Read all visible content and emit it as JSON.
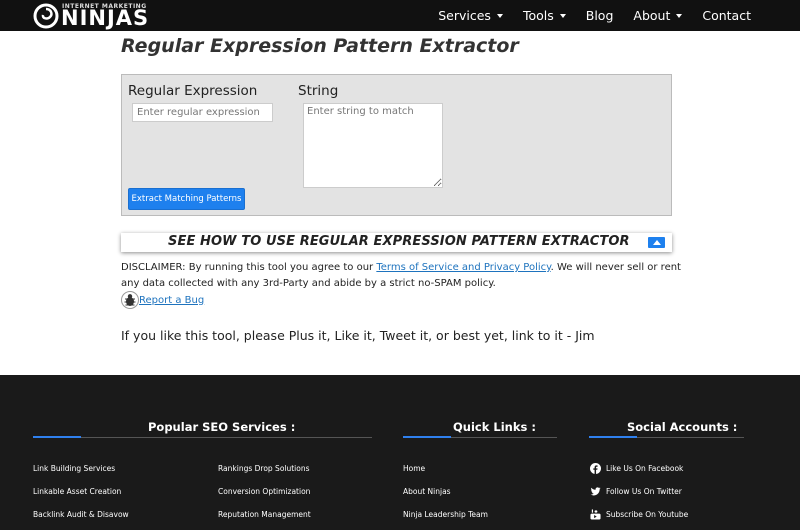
{
  "header": {
    "logo_small": "INTERNET MARKETING",
    "logo_big": "NINJAS",
    "nav": [
      "Services",
      "Tools",
      "Blog",
      "About",
      "Contact"
    ]
  },
  "main": {
    "title": "Regular Expression Pattern Extractor",
    "regex_label": "Regular Expression",
    "regex_placeholder": "Enter regular expression",
    "regex_value": "",
    "string_label": "String",
    "string_placeholder": "Enter string to match",
    "string_value": "",
    "extract_button": "Extract Matching Patterns",
    "howto_title": "SEE HOW TO USE REGULAR EXPRESSION PATTERN EXTRACTOR",
    "disclaimer_pre": "DISCLAIMER: By running this tool you agree to our ",
    "disclaimer_link": "Terms of Service and Privacy Policy",
    "disclaimer_post": ". We will never sell or rent any data collected with any 3rd-Party and abide by a strict no-SPAM policy.",
    "report_bug": "Report a Bug",
    "plus_it": "If you like this tool, please Plus it, Like it, Tweet it, or best yet, link to it - Jim"
  },
  "footer": {
    "popular_heading": "Popular SEO Services :",
    "quick_heading": "Quick Links :",
    "social_heading": "Social Accounts :",
    "popular_col1": [
      "Link Building Services",
      "Linkable Asset Creation",
      "Backlink Audit & Disavow"
    ],
    "popular_col2": [
      "Rankings Drop Solutions",
      "Conversion Optimization",
      "Reputation Management"
    ],
    "quick_links": [
      "Home",
      "About Ninjas",
      "Ninja Leadership Team"
    ],
    "social": [
      {
        "label": "Like Us On Facebook",
        "icon": "facebook-icon"
      },
      {
        "label": "Follow Us On Twitter",
        "icon": "twitter-icon"
      },
      {
        "label": "Subscribe On Youtube",
        "icon": "youtube-icon"
      }
    ]
  },
  "colors": {
    "header_bg": "#111111",
    "accent_blue": "#1e80ee",
    "link_blue": "#1e73be",
    "tool_box_bg": "#e3e3e3",
    "footer_bg": "#1a1a1a"
  }
}
